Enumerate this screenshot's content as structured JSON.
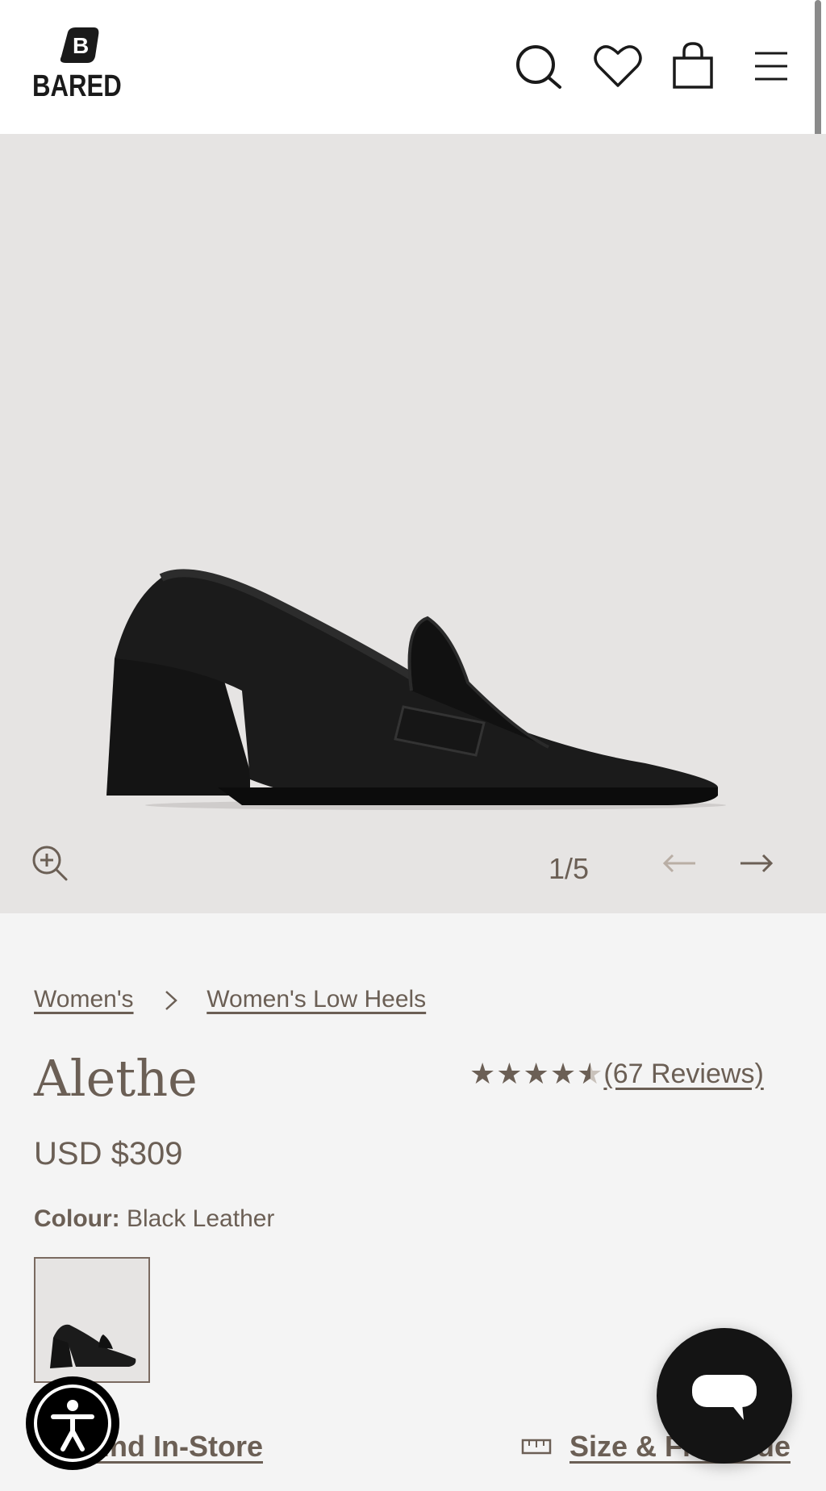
{
  "header": {
    "logo_text": "BARED",
    "icons": [
      "search-icon",
      "heart-icon",
      "bag-icon",
      "menu-icon"
    ]
  },
  "gallery": {
    "counter": "1/5",
    "current_image": 1,
    "total_images": 5
  },
  "breadcrumbs": [
    "Women's",
    "Women's Low Heels"
  ],
  "product": {
    "name": "Alethe",
    "rating": 4.5,
    "reviews_label": "(67 Reviews)",
    "price": "USD $309",
    "colour_label": "Colour:",
    "colour_value": "Black Leather"
  },
  "actions": {
    "find_in_store": "Find In-Store",
    "size_guide": "Size & Fit Guide"
  },
  "colors": {
    "accent": "#6b5f55",
    "hero_bg": "#e6e4e3",
    "page_bg": "#f4f4f4"
  }
}
